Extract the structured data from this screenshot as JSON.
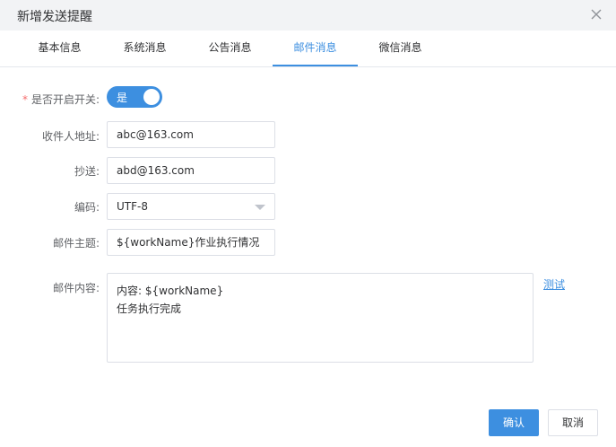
{
  "dialog": {
    "title": "新增发送提醒"
  },
  "tabs": [
    {
      "label": "基本信息"
    },
    {
      "label": "系统消息"
    },
    {
      "label": "公告消息"
    },
    {
      "label": "邮件消息",
      "active": true
    },
    {
      "label": "微信消息"
    }
  ],
  "form": {
    "switch": {
      "label": "是否开启开关:",
      "required_mark": "*",
      "value_text": "是",
      "on": true
    },
    "recipient": {
      "label": "收件人地址:",
      "value": "abc@163.com"
    },
    "cc": {
      "label": "抄送:",
      "value": "abd@163.com"
    },
    "encoding": {
      "label": "编码:",
      "value": "UTF-8"
    },
    "subject": {
      "label": "邮件主题:",
      "value": "${workName}作业执行情况"
    },
    "content": {
      "label": "邮件内容:",
      "line1": "内容: ${workName}",
      "line2": "任务执行完成"
    },
    "test_link": "测试"
  },
  "footer": {
    "confirm_label": "确认",
    "cancel_label": "取消"
  },
  "colors": {
    "accent": "#3d8fe0",
    "required": "#f56c6c",
    "header_bg": "#f2f3f5"
  },
  "icons": {
    "close": "close-icon",
    "dropdown": "chevron-down-icon"
  }
}
